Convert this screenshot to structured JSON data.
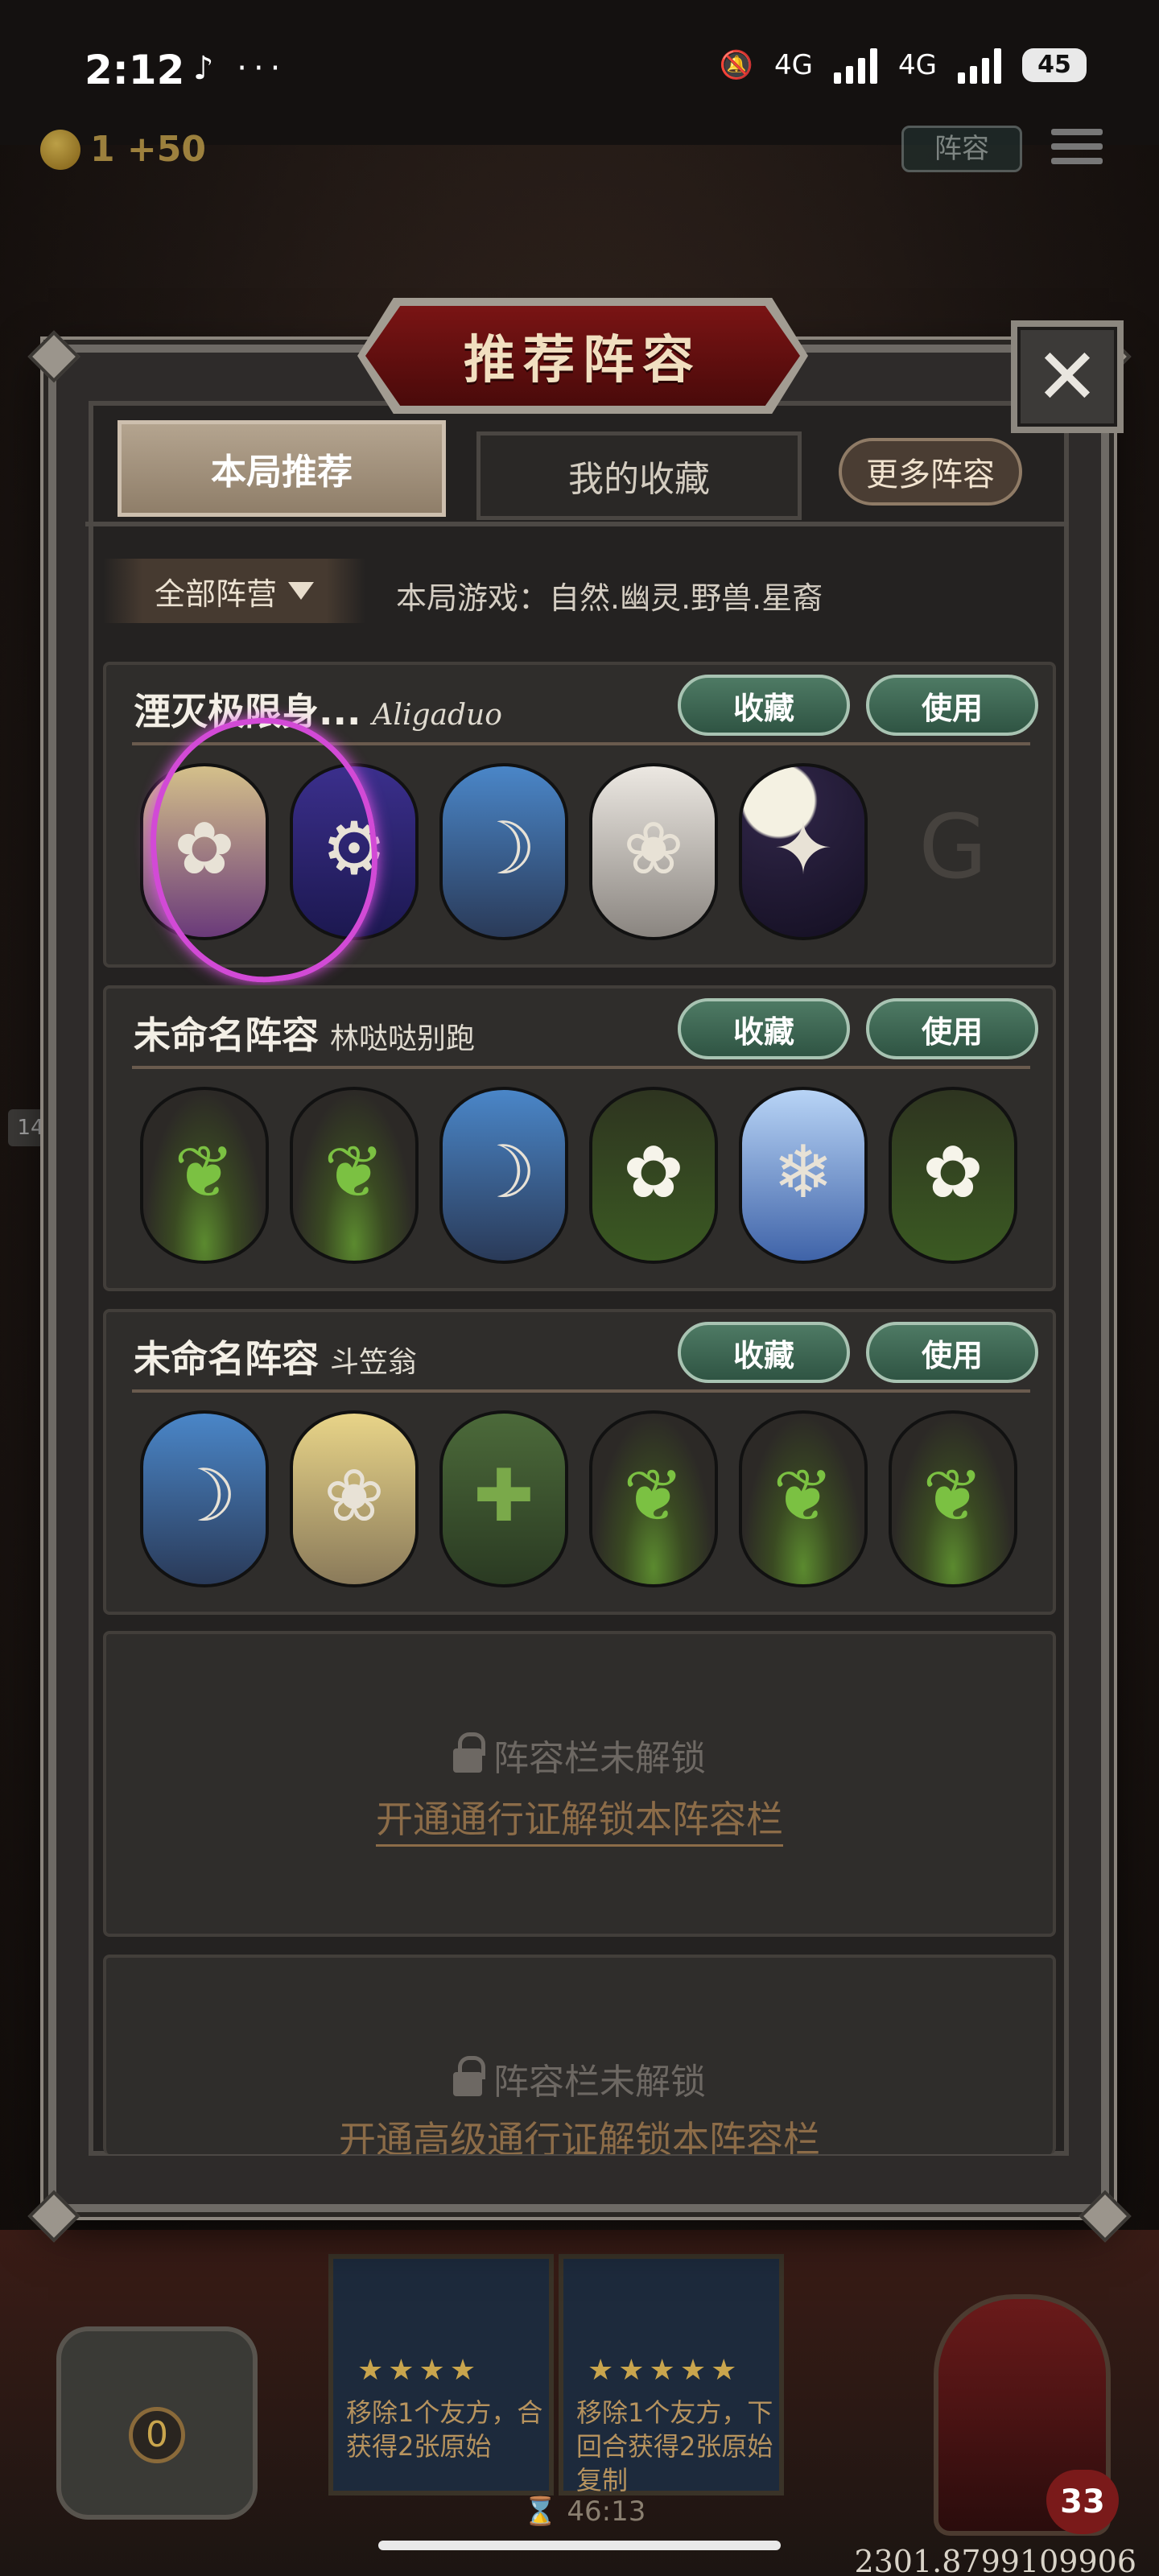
{
  "status_bar": {
    "time": "2:12",
    "icons": "♪ ···",
    "network_1": "4G",
    "network_2": "4G",
    "battery": "45"
  },
  "hud": {
    "coins": "1 +50",
    "lineup_button": "阵容"
  },
  "modal": {
    "title": "推荐阵容",
    "close_label": "✕",
    "tabs": [
      {
        "label": "本局推荐",
        "active": true
      },
      {
        "label": "我的收藏",
        "active": false
      }
    ],
    "more_button": "更多阵容",
    "faction_filter": "全部阵营",
    "game_info": "本局游戏：自然.幽灵.野兽.星裔",
    "lineups": [
      {
        "name": "湮灭极限身...",
        "author": "Aligaduo",
        "favorite_label": "收藏",
        "use_label": "使用",
        "heroes": [
          {
            "icon": "elf-mage-portrait",
            "glyph": "✿"
          },
          {
            "icon": "purple-mech-portrait",
            "glyph": "⚙"
          },
          {
            "icon": "dark-elf-portrait",
            "glyph": "☽"
          },
          {
            "icon": "white-lady-portrait",
            "glyph": "❀"
          },
          {
            "icon": "moon-witch-portrait",
            "glyph": "✦"
          },
          {
            "icon": "empty-slot-emblem",
            "glyph": "G"
          }
        ]
      },
      {
        "name": "未命名阵容",
        "author": "林哒哒别跑",
        "favorite_label": "收藏",
        "use_label": "使用",
        "heroes": [
          {
            "icon": "sprout-portrait",
            "glyph": "❦"
          },
          {
            "icon": "sprout-portrait",
            "glyph": "❦"
          },
          {
            "icon": "dark-elf-portrait",
            "glyph": "☽"
          },
          {
            "icon": "singing-flower-portrait",
            "glyph": "✿"
          },
          {
            "icon": "ice-maiden-portrait",
            "glyph": "❄"
          },
          {
            "icon": "singing-flower-portrait",
            "glyph": "✿"
          }
        ]
      },
      {
        "name": "未命名阵容",
        "author": "斗笠翁",
        "favorite_label": "收藏",
        "use_label": "使用",
        "heroes": [
          {
            "icon": "dark-elf-portrait",
            "glyph": "☽"
          },
          {
            "icon": "blonde-elf-portrait",
            "glyph": "❀"
          },
          {
            "icon": "cactus-portrait",
            "glyph": "✚"
          },
          {
            "icon": "sprout-portrait",
            "glyph": "❦"
          },
          {
            "icon": "sprout-portrait",
            "glyph": "❦"
          },
          {
            "icon": "sprout-portrait",
            "glyph": "❦"
          }
        ]
      }
    ],
    "locked_slots": [
      {
        "message": "阵容栏未解锁",
        "link": "开通通行证解锁本阵容栏"
      },
      {
        "message": "阵容栏未解锁",
        "link": "开通高级通行证解锁本阵容栏"
      }
    ]
  },
  "background": {
    "left_tag": "14",
    "card_1_stars": "★★★★",
    "card_1_text": "移除1个友方，合获得2张原始",
    "card_2_stars": "★★★★★",
    "card_2_text": "移除1个友方，下回合获得2张原始复制",
    "timer": "46:13",
    "shop_count": "0",
    "hp": "33",
    "coords": "2301.8799109906"
  }
}
